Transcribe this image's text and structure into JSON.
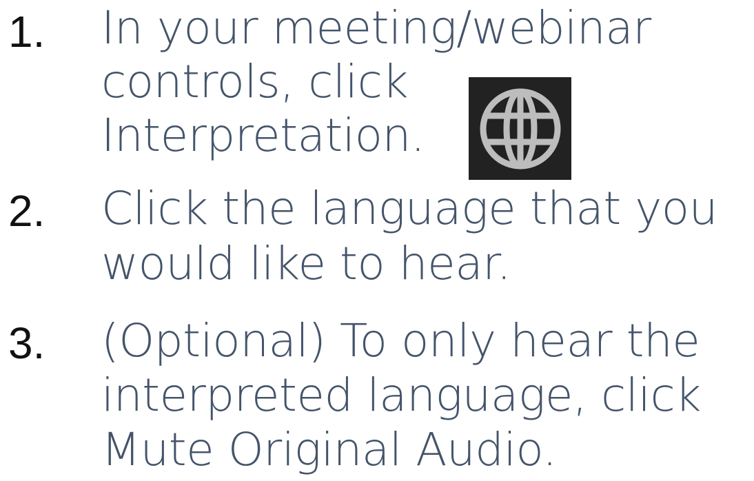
{
  "steps": [
    {
      "number": "1.",
      "lines": [
        "In your meeting/webinar",
        "controls, click",
        "Interpretation."
      ]
    },
    {
      "number": "2.",
      "lines": [
        "Click the language that you",
        "would like to hear."
      ]
    },
    {
      "number": "3.",
      "lines": [
        "(Optional) To only hear the",
        "interpreted language, click",
        "Mute Original Audio."
      ]
    }
  ],
  "icon": {
    "name": "globe-icon",
    "background": "#222222",
    "stroke": "#bdbdbd"
  },
  "colors": {
    "number": "#111111",
    "text": "#44546a"
  }
}
